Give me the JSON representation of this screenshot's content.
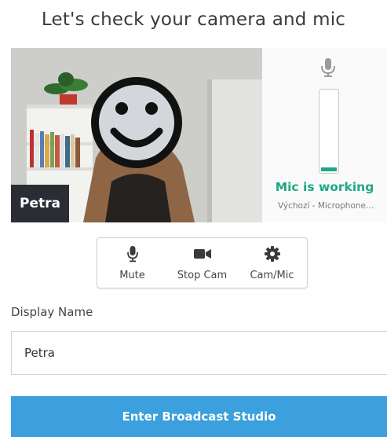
{
  "page": {
    "title": "Let's check your camera and mic"
  },
  "preview": {
    "participant_name": "Petra",
    "mic_status": "Mic is working",
    "mic_device": "Výchozí - Microphone...",
    "mic_level": 0.05
  },
  "controls": {
    "mute_label": "Mute",
    "stop_cam_label": "Stop Cam",
    "cam_mic_label": "Cam/Mic",
    "icons": [
      "microphone-icon",
      "video-camera-icon",
      "gear-icon"
    ]
  },
  "form": {
    "display_name_label": "Display Name",
    "display_name_value": "Petra"
  },
  "actions": {
    "enter_label": "Enter Broadcast Studio"
  },
  "colors": {
    "accent_blue": "#3ba0dd",
    "success_green": "#1ea885",
    "name_tag_bg": "#2a2d33"
  }
}
